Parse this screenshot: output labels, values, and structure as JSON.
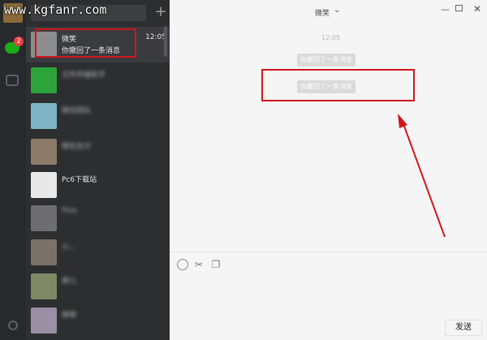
{
  "watermark": "www.kgfanr.com",
  "nav": {
    "unread_badge": "2"
  },
  "conversation_list": {
    "add_label": "+",
    "items": [
      {
        "name": "微笑",
        "time": "12:05",
        "preview": "你撤回了一条消息",
        "selected": true
      },
      {
        "name": "文件传输助手",
        "time": "",
        "preview": "",
        "blurred": true
      },
      {
        "name": "微信团队",
        "time": "",
        "preview": "",
        "blurred": true
      },
      {
        "name": "微信支付",
        "time": "",
        "preview": "",
        "blurred": true
      },
      {
        "name": "Pc6下载站",
        "time": "",
        "preview": "",
        "blurred": false
      },
      {
        "name": "Pino",
        "time": "",
        "preview": "",
        "blurred": true
      },
      {
        "name": "小...",
        "time": "",
        "preview": "",
        "blurred": true
      },
      {
        "name": "婷儿",
        "time": "",
        "preview": "",
        "blurred": true
      },
      {
        "name": "婷婷",
        "time": "",
        "preview": "",
        "blurred": true
      }
    ]
  },
  "chat": {
    "title": "微笑",
    "title_arrow": "⌄",
    "timestamp": "12:05",
    "system_messages": [
      "你撤回了一条消息",
      "你撤回了一条消息"
    ],
    "send_label": "发送"
  },
  "colors": {
    "accent_green": "#1aad19",
    "annotation_red": "#d0161c"
  }
}
